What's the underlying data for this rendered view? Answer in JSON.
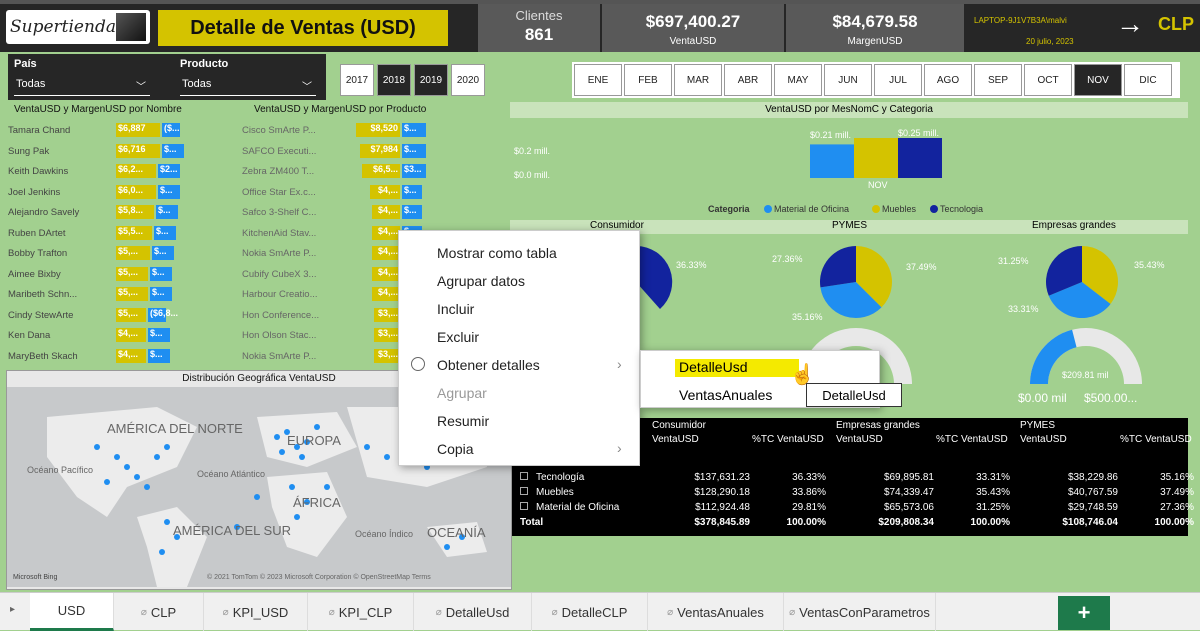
{
  "header": {
    "logo_text": "Supertienda",
    "title": "Detalle de Ventas (USD)"
  },
  "kpis": [
    {
      "label": "Clientes",
      "value": "861"
    },
    {
      "label": "VentaUSD",
      "value": "$697,400.27"
    },
    {
      "label": "MargenUSD",
      "value": "$84,679.58"
    }
  ],
  "user": {
    "name": "LAPTOP-9J1V7B3A\\malvi",
    "date": "20 julio, 2023",
    "currency": "CLP"
  },
  "filters": [
    {
      "label": "País",
      "value": "Todas"
    },
    {
      "label": "Producto",
      "value": "Todas"
    }
  ],
  "years": [
    {
      "label": "2017",
      "selected": false
    },
    {
      "label": "2018",
      "selected": true
    },
    {
      "label": "2019",
      "selected": true
    },
    {
      "label": "2020",
      "selected": false
    }
  ],
  "months": [
    {
      "label": "ENE",
      "selected": false
    },
    {
      "label": "FEB",
      "selected": false
    },
    {
      "label": "MAR",
      "selected": false
    },
    {
      "label": "ABR",
      "selected": false
    },
    {
      "label": "MAY",
      "selected": false
    },
    {
      "label": "JUN",
      "selected": false
    },
    {
      "label": "JUL",
      "selected": false
    },
    {
      "label": "AGO",
      "selected": false
    },
    {
      "label": "SEP",
      "selected": false
    },
    {
      "label": "OCT",
      "selected": false
    },
    {
      "label": "NOV",
      "selected": true
    },
    {
      "label": "DIC",
      "selected": false
    }
  ],
  "bynombre": {
    "title": "VentaUSD y MargenUSD por Nombre",
    "rows": [
      {
        "name": "Tamara Chand",
        "venta": "$6,887",
        "margen": "($..."
      },
      {
        "name": "Sung Pak",
        "venta": "$6,716",
        "margen": "$..."
      },
      {
        "name": "Keith Dawkins",
        "venta": "$6,2...",
        "margen": "$2..."
      },
      {
        "name": "Joel Jenkins",
        "venta": "$6,0...",
        "margen": "$..."
      },
      {
        "name": "Alejandro Savely",
        "venta": "$5,8...",
        "margen": "$..."
      },
      {
        "name": "Ruben DArtet",
        "venta": "$5,5...",
        "margen": "$..."
      },
      {
        "name": "Bobby Trafton",
        "venta": "$5,...",
        "margen": "$..."
      },
      {
        "name": "Aimee Bixby",
        "venta": "$5,...",
        "margen": "$..."
      },
      {
        "name": "Maribeth Schn...",
        "venta": "$5,...",
        "margen": "$..."
      },
      {
        "name": "Cindy StewArte",
        "venta": "$5,...",
        "margen": "($6,8..."
      },
      {
        "name": "Ken Dana",
        "venta": "$4,...",
        "margen": "$..."
      },
      {
        "name": "MaryBeth Skach",
        "venta": "$4,...",
        "margen": "$..."
      }
    ]
  },
  "byproducto": {
    "title": "VentaUSD y MargenUSD por Producto",
    "rows": [
      {
        "name": "Cisco SmArte P...",
        "venta": "$8,520",
        "margen": "$..."
      },
      {
        "name": "SAFCO Executi...",
        "venta": "$7,984",
        "margen": "$..."
      },
      {
        "name": "Zebra ZM400 T...",
        "venta": "$6,5...",
        "margen": "$3..."
      },
      {
        "name": "Office Star Ex.c...",
        "venta": "$4,...",
        "margen": "$..."
      },
      {
        "name": "Safco 3-Shelf C...",
        "venta": "$4,...",
        "margen": "$..."
      },
      {
        "name": "KitchenAid Stav...",
        "venta": "$4,...",
        "margen": "$..."
      },
      {
        "name": "Nokia SmArte P...",
        "venta": "$4,...",
        "margen": "$..."
      },
      {
        "name": "Cubify CubeX 3...",
        "venta": "$4,...",
        "margen": "$..."
      },
      {
        "name": "Harbour Creatio...",
        "venta": "$4,...",
        "margen": "$..."
      },
      {
        "name": "Hon Conference...",
        "venta": "$3,...",
        "margen": "$..."
      },
      {
        "name": "Hon Olson Stac...",
        "venta": "$3,...",
        "margen": "$..."
      },
      {
        "name": "Nokia SmArte P...",
        "venta": "$3,...",
        "margen": "$..."
      }
    ]
  },
  "mes_chart": {
    "title": "VentaUSD por MesNomC y Categoria",
    "legend_title": "Categoria"
  },
  "chart_data": [
    {
      "type": "bar",
      "title": "VentaUSD por MesNomC y Categoria",
      "categories": [
        "NOV"
      ],
      "series": [
        {
          "name": "Material de Oficina",
          "values": [
            0.21
          ]
        },
        {
          "name": "Muebles",
          "values": [
            0.25
          ]
        },
        {
          "name": "Tecnologia",
          "values": [
            0.25
          ]
        }
      ],
      "ytick_labels": [
        "$0.2 mill.",
        "$0.0 mill."
      ],
      "data_labels": [
        "$0.21 mill.",
        "$0.25 mill."
      ]
    },
    {
      "type": "pie",
      "title": "PYMES",
      "values": [
        35.16,
        37.49,
        27.36
      ]
    },
    {
      "type": "pie",
      "title": "Empresas grandes",
      "values": [
        33.31,
        35.43,
        31.25
      ]
    },
    {
      "type": "pie",
      "title": "Consumidor",
      "values": [
        36.33
      ]
    }
  ],
  "segments": [
    "Consumidor",
    "PYMES",
    "Empresas grandes"
  ],
  "pie_labels": {
    "consumidor": "36.33%",
    "pymes": [
      "27.36%",
      "37.49%",
      "35.16%"
    ],
    "empresas": [
      "31.25%",
      "35.43%",
      "33.31%"
    ]
  },
  "gauge": {
    "value": "$209.81 mil",
    "min": "$0.00 mil",
    "max": "$500.00..."
  },
  "map": {
    "title": "Distribución Geográfica VentaUSD",
    "labels": {
      "na": "AMÉRICA DEL NORTE",
      "sa": "AMÉRICA DEL SUR",
      "eu": "EUROPA",
      "af": "ÁFRICA",
      "oc": "OCEANÍA",
      "op": "Océano Pacífico",
      "oa": "Océano Atlántico",
      "oi": "Océano Índico"
    },
    "attribution": "© 2021 TomTom © 2023 Microsoft Corporation © OpenStreetMap Terms",
    "brand": "Microsoft Bing"
  },
  "context_menu": {
    "items": [
      {
        "label": "Mostrar como tabla",
        "enabled": true
      },
      {
        "label": "Agrupar datos",
        "enabled": true
      },
      {
        "label": "Incluir",
        "enabled": true
      },
      {
        "label": "Excluir",
        "enabled": true
      },
      {
        "label": "Obtener detalles",
        "enabled": true
      },
      {
        "label": "Agrupar",
        "enabled": false
      },
      {
        "label": "Resumir",
        "enabled": true
      },
      {
        "label": "Copia",
        "enabled": true
      }
    ]
  },
  "submenu": {
    "items": [
      "DetalleUsd",
      "VentasAnuales"
    ]
  },
  "tooltip": "DetalleUsd",
  "table": {
    "groups": [
      "Consumidor",
      "Empresas grandes",
      "PYMES"
    ],
    "cols": [
      "VentaUSD",
      "%TC VentaUSD"
    ],
    "rows": [
      {
        "cat": "Tecnología",
        "v": [
          "$137,631.23",
          "36.33%",
          "$69,895.81",
          "33.31%",
          "$38,229.86",
          "35.16%"
        ]
      },
      {
        "cat": "Muebles",
        "v": [
          "$128,290.18",
          "33.86%",
          "$74,339.47",
          "35.43%",
          "$40,767.59",
          "37.49%"
        ]
      },
      {
        "cat": "Material de Oficina",
        "v": [
          "$112,924.48",
          "29.81%",
          "$65,573.06",
          "31.25%",
          "$29,748.59",
          "27.36%"
        ]
      },
      {
        "cat": "Total",
        "v": [
          "$378,845.89",
          "100.00%",
          "$209,808.34",
          "100.00%",
          "$108,746.04",
          "100.00%"
        ]
      }
    ]
  },
  "tabs": [
    "USD",
    "CLP",
    "KPI_USD",
    "KPI_CLP",
    "DetalleUsd",
    "DetalleCLP",
    "VentasAnuales",
    "VentasConParametros"
  ],
  "colors": {
    "yellow": "#d4c300",
    "blue": "#1f8ef1",
    "navy": "#12239e",
    "bg": "#a2d08f"
  }
}
